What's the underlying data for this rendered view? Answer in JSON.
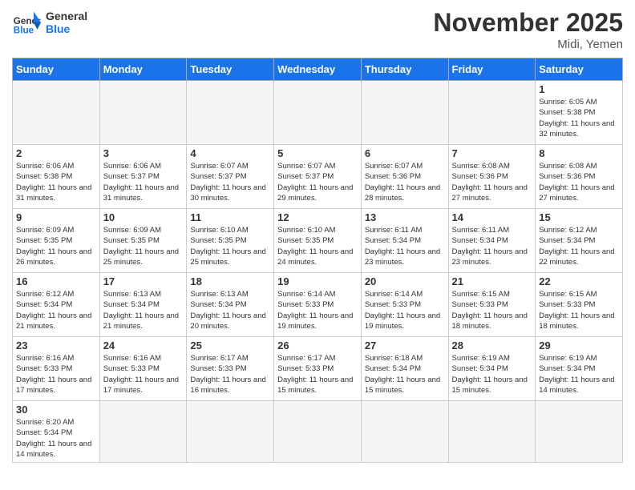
{
  "header": {
    "logo_general": "General",
    "logo_blue": "Blue",
    "month_title": "November 2025",
    "location": "Midi, Yemen"
  },
  "weekdays": [
    "Sunday",
    "Monday",
    "Tuesday",
    "Wednesday",
    "Thursday",
    "Friday",
    "Saturday"
  ],
  "weeks": [
    [
      {
        "day": "",
        "info": ""
      },
      {
        "day": "",
        "info": ""
      },
      {
        "day": "",
        "info": ""
      },
      {
        "day": "",
        "info": ""
      },
      {
        "day": "",
        "info": ""
      },
      {
        "day": "",
        "info": ""
      },
      {
        "day": "1",
        "info": "Sunrise: 6:05 AM\nSunset: 5:38 PM\nDaylight: 11 hours\nand 32 minutes."
      }
    ],
    [
      {
        "day": "2",
        "info": "Sunrise: 6:06 AM\nSunset: 5:38 PM\nDaylight: 11 hours\nand 31 minutes."
      },
      {
        "day": "3",
        "info": "Sunrise: 6:06 AM\nSunset: 5:37 PM\nDaylight: 11 hours\nand 31 minutes."
      },
      {
        "day": "4",
        "info": "Sunrise: 6:07 AM\nSunset: 5:37 PM\nDaylight: 11 hours\nand 30 minutes."
      },
      {
        "day": "5",
        "info": "Sunrise: 6:07 AM\nSunset: 5:37 PM\nDaylight: 11 hours\nand 29 minutes."
      },
      {
        "day": "6",
        "info": "Sunrise: 6:07 AM\nSunset: 5:36 PM\nDaylight: 11 hours\nand 28 minutes."
      },
      {
        "day": "7",
        "info": "Sunrise: 6:08 AM\nSunset: 5:36 PM\nDaylight: 11 hours\nand 27 minutes."
      },
      {
        "day": "8",
        "info": "Sunrise: 6:08 AM\nSunset: 5:36 PM\nDaylight: 11 hours\nand 27 minutes."
      }
    ],
    [
      {
        "day": "9",
        "info": "Sunrise: 6:09 AM\nSunset: 5:35 PM\nDaylight: 11 hours\nand 26 minutes."
      },
      {
        "day": "10",
        "info": "Sunrise: 6:09 AM\nSunset: 5:35 PM\nDaylight: 11 hours\nand 25 minutes."
      },
      {
        "day": "11",
        "info": "Sunrise: 6:10 AM\nSunset: 5:35 PM\nDaylight: 11 hours\nand 25 minutes."
      },
      {
        "day": "12",
        "info": "Sunrise: 6:10 AM\nSunset: 5:35 PM\nDaylight: 11 hours\nand 24 minutes."
      },
      {
        "day": "13",
        "info": "Sunrise: 6:11 AM\nSunset: 5:34 PM\nDaylight: 11 hours\nand 23 minutes."
      },
      {
        "day": "14",
        "info": "Sunrise: 6:11 AM\nSunset: 5:34 PM\nDaylight: 11 hours\nand 23 minutes."
      },
      {
        "day": "15",
        "info": "Sunrise: 6:12 AM\nSunset: 5:34 PM\nDaylight: 11 hours\nand 22 minutes."
      }
    ],
    [
      {
        "day": "16",
        "info": "Sunrise: 6:12 AM\nSunset: 5:34 PM\nDaylight: 11 hours\nand 21 minutes."
      },
      {
        "day": "17",
        "info": "Sunrise: 6:13 AM\nSunset: 5:34 PM\nDaylight: 11 hours\nand 21 minutes."
      },
      {
        "day": "18",
        "info": "Sunrise: 6:13 AM\nSunset: 5:34 PM\nDaylight: 11 hours\nand 20 minutes."
      },
      {
        "day": "19",
        "info": "Sunrise: 6:14 AM\nSunset: 5:33 PM\nDaylight: 11 hours\nand 19 minutes."
      },
      {
        "day": "20",
        "info": "Sunrise: 6:14 AM\nSunset: 5:33 PM\nDaylight: 11 hours\nand 19 minutes."
      },
      {
        "day": "21",
        "info": "Sunrise: 6:15 AM\nSunset: 5:33 PM\nDaylight: 11 hours\nand 18 minutes."
      },
      {
        "day": "22",
        "info": "Sunrise: 6:15 AM\nSunset: 5:33 PM\nDaylight: 11 hours\nand 18 minutes."
      }
    ],
    [
      {
        "day": "23",
        "info": "Sunrise: 6:16 AM\nSunset: 5:33 PM\nDaylight: 11 hours\nand 17 minutes."
      },
      {
        "day": "24",
        "info": "Sunrise: 6:16 AM\nSunset: 5:33 PM\nDaylight: 11 hours\nand 17 minutes."
      },
      {
        "day": "25",
        "info": "Sunrise: 6:17 AM\nSunset: 5:33 PM\nDaylight: 11 hours\nand 16 minutes."
      },
      {
        "day": "26",
        "info": "Sunrise: 6:17 AM\nSunset: 5:33 PM\nDaylight: 11 hours\nand 15 minutes."
      },
      {
        "day": "27",
        "info": "Sunrise: 6:18 AM\nSunset: 5:34 PM\nDaylight: 11 hours\nand 15 minutes."
      },
      {
        "day": "28",
        "info": "Sunrise: 6:19 AM\nSunset: 5:34 PM\nDaylight: 11 hours\nand 15 minutes."
      },
      {
        "day": "29",
        "info": "Sunrise: 6:19 AM\nSunset: 5:34 PM\nDaylight: 11 hours\nand 14 minutes."
      }
    ],
    [
      {
        "day": "30",
        "info": "Sunrise: 6:20 AM\nSunset: 5:34 PM\nDaylight: 11 hours\nand 14 minutes."
      },
      {
        "day": "",
        "info": ""
      },
      {
        "day": "",
        "info": ""
      },
      {
        "day": "",
        "info": ""
      },
      {
        "day": "",
        "info": ""
      },
      {
        "day": "",
        "info": ""
      },
      {
        "day": "",
        "info": ""
      }
    ]
  ]
}
